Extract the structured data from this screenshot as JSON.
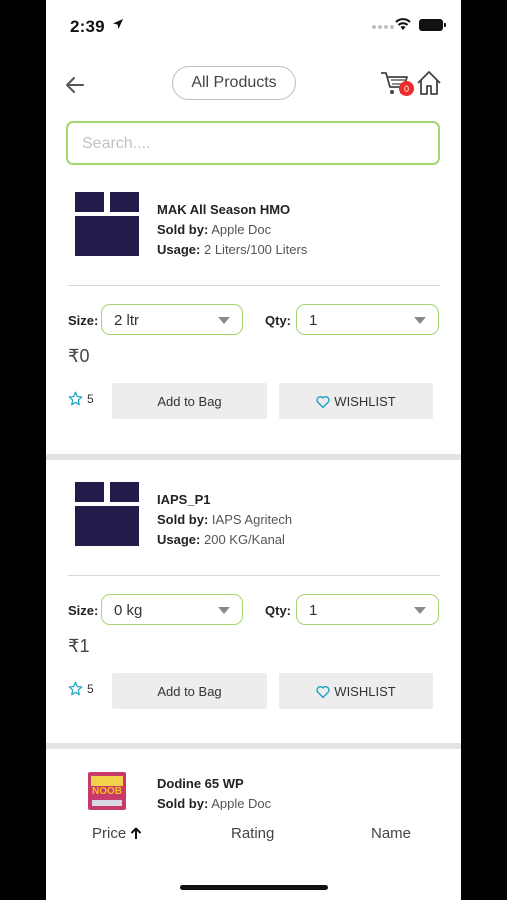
{
  "status_bar": {
    "time": "2:39"
  },
  "header": {
    "title": "All Products",
    "cart_count": "0"
  },
  "search": {
    "placeholder": "Search...."
  },
  "labels": {
    "sold_by": "Sold by:",
    "usage": "Usage:",
    "size": "Size:",
    "qty": "Qty:",
    "add_to_bag": "Add to Bag",
    "wishlist": "WISHLIST"
  },
  "products": [
    {
      "name": "MAK All Season HMO",
      "sold_by": "Apple Doc",
      "usage": "2 Liters/100 Liters",
      "size": "2 ltr",
      "qty": "1",
      "price": "₹0",
      "rating": "5"
    },
    {
      "name": "IAPS_P1",
      "sold_by": "IAPS Agritech",
      "usage": "200 KG/Kanal",
      "size": "0 kg",
      "qty": "1",
      "price": "₹1",
      "rating": "5"
    },
    {
      "name": "Dodine 65 WP",
      "sold_by": "Apple Doc",
      "pack_label": "NOOB"
    }
  ],
  "sort": {
    "price": "Price",
    "rating": "Rating",
    "name": "Name"
  },
  "colors": {
    "accent_green": "#a4d66d",
    "badge_red": "#ee2b2b",
    "box_navy": "#231c4a",
    "heart_teal": "#1aa3c4"
  }
}
